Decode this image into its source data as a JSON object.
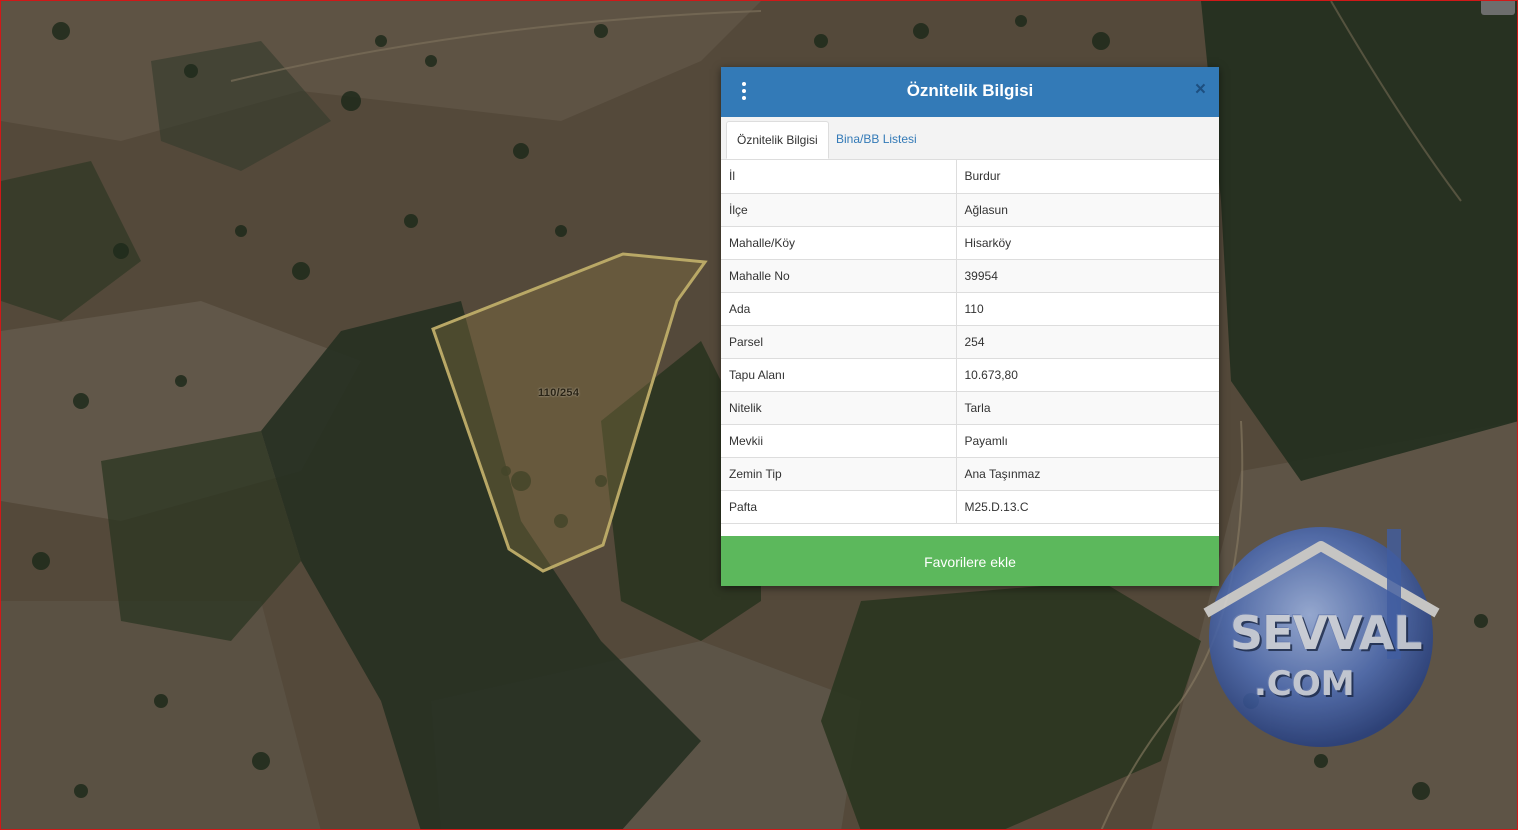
{
  "map": {
    "parcel_label": "110/254",
    "parcel_outline_color": "#b9a866"
  },
  "dialog": {
    "title": "Öznitelik Bilgisi",
    "menu_icon": "kebab-menu-icon",
    "close_label": "×",
    "tabs": [
      {
        "label": "Öznitelik Bilgisi",
        "active": true
      },
      {
        "label": "Bina/BB Listesi",
        "active": false
      }
    ],
    "rows": [
      {
        "key": "İl",
        "value": "Burdur"
      },
      {
        "key": "İlçe",
        "value": "Ağlasun"
      },
      {
        "key": "Mahalle/Köy",
        "value": "Hisarköy"
      },
      {
        "key": "Mahalle No",
        "value": "39954"
      },
      {
        "key": "Ada",
        "value": "110"
      },
      {
        "key": "Parsel",
        "value": "254"
      },
      {
        "key": "Tapu Alanı",
        "value": "10.673,80"
      },
      {
        "key": "Nitelik",
        "value": "Tarla"
      },
      {
        "key": "Mevkii",
        "value": "Payamlı"
      },
      {
        "key": "Zemin Tip",
        "value": "Ana Taşınmaz"
      },
      {
        "key": "Pafta",
        "value": "M25.D.13.C"
      }
    ],
    "favorite_button": "Favorilere ekle",
    "colors": {
      "header": "#337ab7",
      "button": "#5cb85c"
    }
  },
  "watermark": {
    "line1": "SEVVAL",
    "line2": ".COM"
  }
}
